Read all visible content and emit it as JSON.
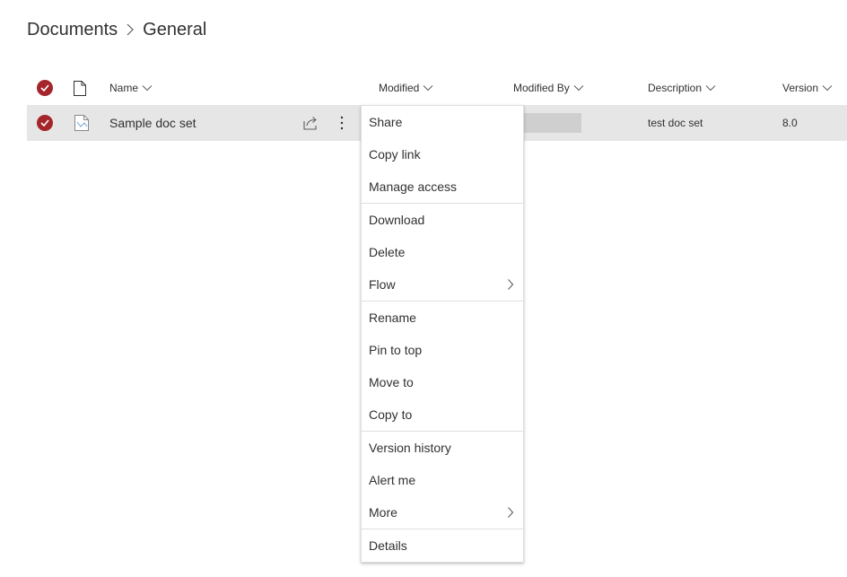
{
  "breadcrumb": {
    "items": [
      "Documents",
      "General"
    ]
  },
  "columns": {
    "name": "Name",
    "modified": "Modified",
    "modified_by": "Modified By",
    "description": "Description",
    "version": "Version"
  },
  "row": {
    "name": "Sample doc set",
    "description": "test doc set",
    "version": "8.0"
  },
  "context_menu": {
    "groups": [
      [
        "Share",
        "Copy link",
        "Manage access"
      ],
      [
        "Download",
        "Delete",
        "Flow"
      ],
      [
        "Rename",
        "Pin to top",
        "Move to",
        "Copy to"
      ],
      [
        "Version history",
        "Alert me",
        "More"
      ],
      [
        "Details"
      ]
    ]
  },
  "colors": {
    "accent": "#a4262c",
    "selected_row": "#e6e6e6"
  }
}
